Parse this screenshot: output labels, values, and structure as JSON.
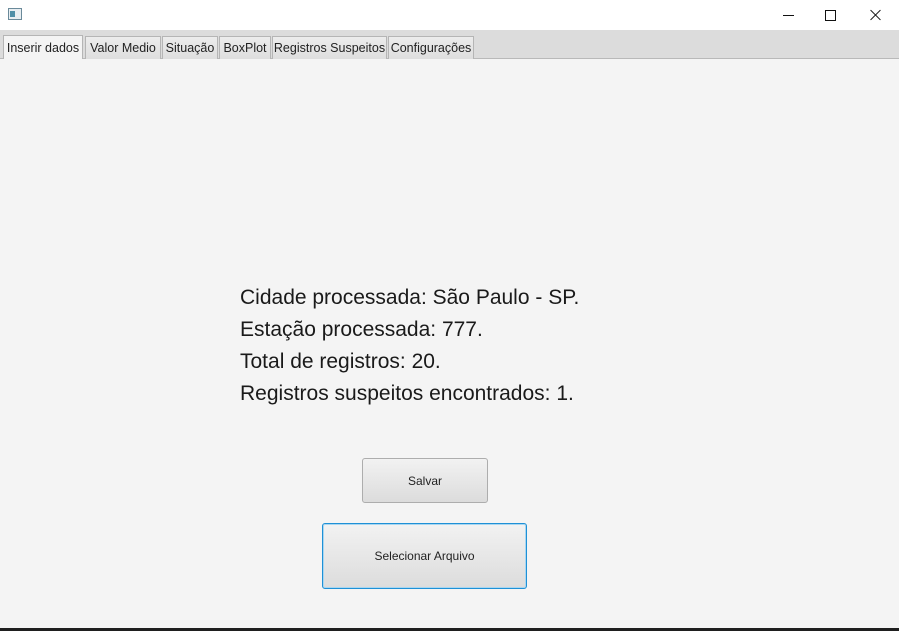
{
  "window": {
    "icon": "app-window-icon",
    "controls": {
      "minimize": "minimize-icon",
      "maximize": "maximize-icon",
      "close": "close-icon"
    }
  },
  "tabs": [
    {
      "label": "Inserir dados",
      "active": true
    },
    {
      "label": "Valor Medio",
      "active": false
    },
    {
      "label": "Situação",
      "active": false
    },
    {
      "label": "BoxPlot",
      "active": false
    },
    {
      "label": "Registros Suspeitos",
      "active": false
    },
    {
      "label": "Configurações",
      "active": false
    }
  ],
  "info": {
    "city": "Cidade processada: São Paulo - SP.",
    "station": "Estação processada: 777.",
    "total": "Total de registros: 20.",
    "suspicious": "Registros suspeitos encontrados: 1."
  },
  "buttons": {
    "save_label": "Salvar",
    "select_file_label": "Selecionar Arquivo"
  },
  "colors": {
    "focus_border": "#1e90d6",
    "background": "#f4f4f4"
  }
}
